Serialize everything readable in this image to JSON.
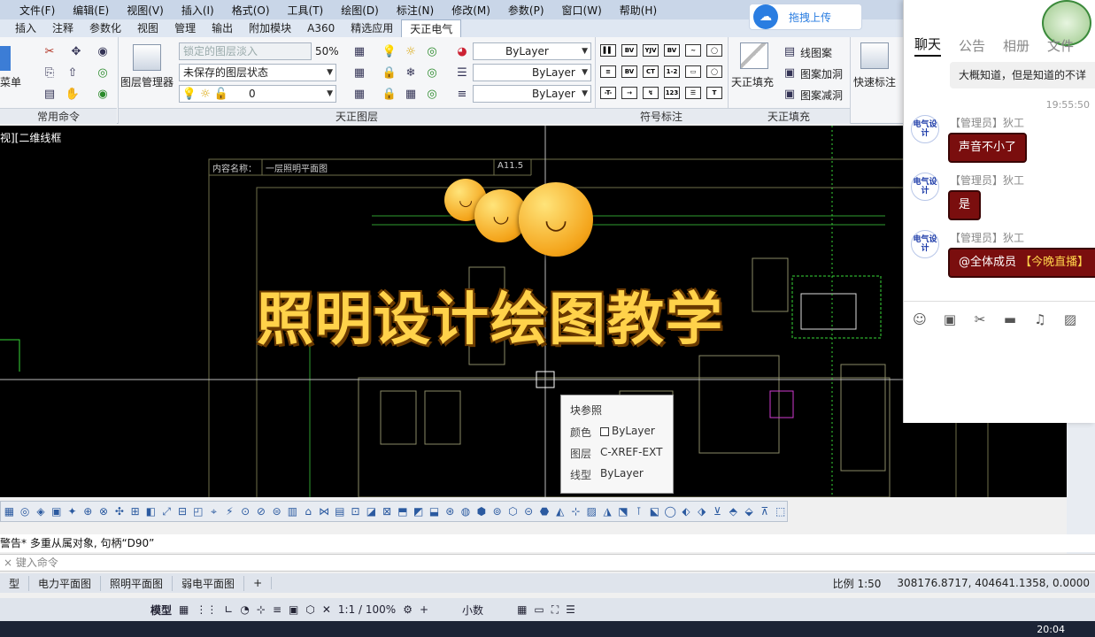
{
  "menu": [
    "文件(F)",
    "编辑(E)",
    "视图(V)",
    "插入(I)",
    "格式(O)",
    "工具(T)",
    "绘图(D)",
    "标注(N)",
    "修改(M)",
    "参数(P)",
    "窗口(W)",
    "帮助(H)"
  ],
  "ribbon_tabs": [
    "插入",
    "注释",
    "参数化",
    "视图",
    "管理",
    "输出",
    "附加模块",
    "A360",
    "精选应用",
    "天正电气"
  ],
  "active_tab": "天正电气",
  "upload": {
    "label": "拖拽上传"
  },
  "ribbon": {
    "menu_label": "菜单",
    "common_panel": "常用命令",
    "layer_manager": "图层管理器",
    "layer_state_placeholder": "锁定的图层淡入",
    "layer_fade": "50%",
    "layer_state": "未保存的图层状态",
    "current_layer": "0",
    "layers_panel": "天正图层",
    "color_combo": "ByLayer",
    "linetype_combo": "ByLayer",
    "lineweight_combo": "ByLayer",
    "symbols_panel": "符号标注",
    "fill_label": "天正填充",
    "line_pattern": "线图案",
    "pattern_add_hole": "图案加洞",
    "pattern_remove_hole": "图案减洞",
    "fill_panel": "天正填充",
    "quick_dim": "快速标注"
  },
  "canvas": {
    "view_label": "视][二维线框",
    "overlay_title": "照明设计绘图教学",
    "drawing_title_label": "内容名称：",
    "drawing_title_value": "一层照明平面图",
    "drawing_code": "A11.5"
  },
  "tooltip": {
    "title": "块参照",
    "rows": [
      {
        "key": "颜色",
        "value": "ByLayer"
      },
      {
        "key": "图层",
        "value": "C-XREF-EXT"
      },
      {
        "key": "线型",
        "value": "ByLayer"
      }
    ]
  },
  "command": {
    "history": "警告* 多重从属对象, 句柄“D90”",
    "placeholder": "键入命令"
  },
  "layout_tabs": [
    "型",
    "电力平面图",
    "照明平面图",
    "弱电平面图",
    "+"
  ],
  "status": {
    "scale": "比例 1:50",
    "coords": "308176.8717, 404641.1358, 0.0000",
    "model": "模型",
    "zoom": "1:1 / 100%",
    "units": "小数",
    "clock": "20:04"
  },
  "chat": {
    "tabs": [
      "聊天",
      "公告",
      "相册",
      "文件"
    ],
    "active_tab": "聊天",
    "prev_message": "大概知道，但是知道的不详",
    "time": "19:55:50",
    "avatar_text": "电气设计",
    "messages": [
      {
        "sender": "【管理员】狄工",
        "text": "声音不小了"
      },
      {
        "sender": "【管理员】狄工",
        "text": "是"
      },
      {
        "sender": "【管理员】狄工",
        "mention": "@全体成员",
        "text": "【今晚直播】"
      }
    ]
  }
}
